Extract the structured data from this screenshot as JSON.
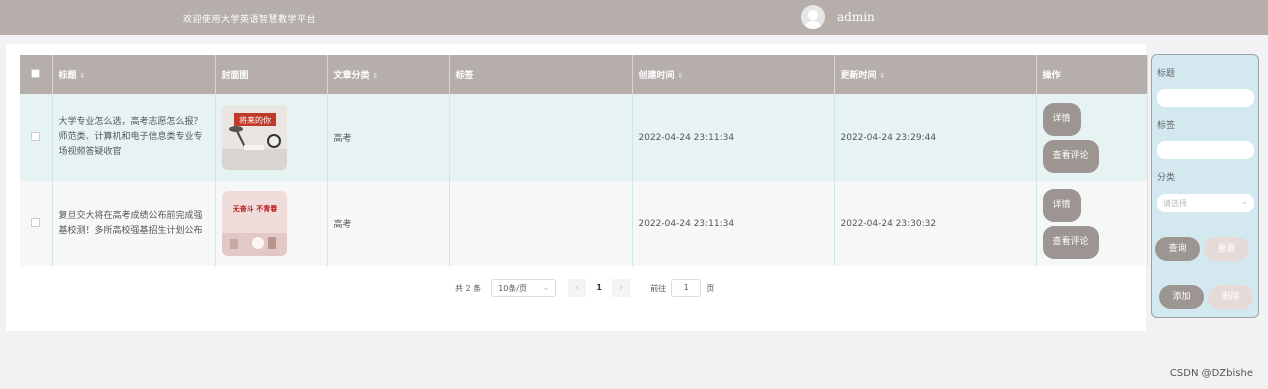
{
  "header": {
    "welcome": "欢迎使用大学英语智慧教学平台",
    "username": "admin"
  },
  "table": {
    "columns": [
      "标题",
      "封面图",
      "文章分类",
      "标签",
      "创建时间",
      "更新时间",
      "操作"
    ],
    "rows": [
      {
        "title": "大学专业怎么选，高考志愿怎么报？师范类、计算机和电子信息类专业专场视频答疑收官",
        "category": "高考",
        "tags": "",
        "created": "2022-04-24 23:11:34",
        "updated": "2022-04-24 23:29:44",
        "detail": "详情",
        "comments": "查看评论",
        "cover_text": "将来的你"
      },
      {
        "title": "复旦交大将在高考成绩公布前完成强基校测！多所高校强基招生计划公布",
        "category": "高考",
        "tags": "",
        "created": "2022-04-24 23:11:34",
        "updated": "2022-04-24 23:30:32",
        "detail": "详情",
        "comments": "查看评论",
        "cover_text": "无奋斗 不青春"
      }
    ]
  },
  "pagination": {
    "total": "共 2 条",
    "page_size": "10条/页",
    "current": "1",
    "goto_prefix": "前往",
    "goto_value": "1",
    "goto_suffix": "页"
  },
  "search_panel": {
    "title_label": "标题",
    "tags_label": "标签",
    "category_label": "分类",
    "category_placeholder": "请选择",
    "query": "查询",
    "reset": "重置",
    "add": "添加",
    "delete": "删除"
  },
  "watermark": "CSDN @DZbishe",
  "colors": {
    "header_bg": "#b5aeab",
    "button": "#9c9592",
    "panel_bg": "#d4e8f0"
  }
}
